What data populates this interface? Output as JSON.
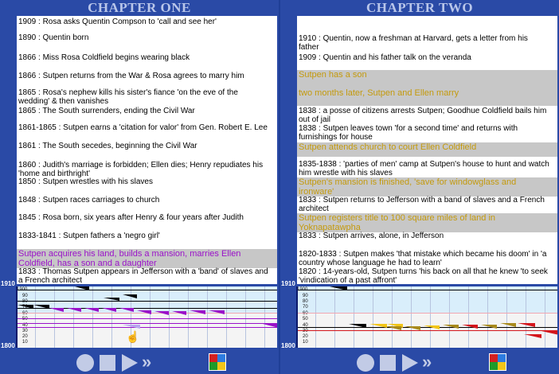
{
  "panels": [
    {
      "title": "CHAPTER ONE",
      "events": [
        {
          "text": "1909 : Rosa asks Quentin Compson to 'call and see her'",
          "style": "normal"
        },
        {
          "text": "1890 : Quentin born",
          "style": "normal"
        },
        {
          "text": "1866 : Miss Rosa Coldfield begins wearing black",
          "style": "normal"
        },
        {
          "text": "1866 : Sutpen returns from the War & Rosa agrees to marry him",
          "style": "normal"
        },
        {
          "text": "1865 : Rosa's nephew kills his sister's fiance 'on the eve of the wedding' & then vanishes",
          "style": "normal"
        },
        {
          "text": "1865 : The South surrenders, ending the Civil War",
          "style": "normal"
        },
        {
          "text": "1861-1865 : Sutpen earns a 'citation for valor' from Gen. Robert E. Lee",
          "style": "normal"
        },
        {
          "text": "1861 : The South secedes, beginning the Civil War",
          "style": "normal"
        },
        {
          "text": "1860 : Judith's marriage is forbidden; Ellen dies; Henry repudiates his 'home and  birthright'",
          "style": "normal"
        },
        {
          "text": "1850 : Sutpen wrestles with his slaves",
          "style": "normal"
        },
        {
          "text": "1848 : Sutpen races carriages to church",
          "style": "normal"
        },
        {
          "text": "1845 : Rosa born, six years after Henry & four years after Judith",
          "style": "normal"
        },
        {
          "text": "1833-1841 : Sutpen fathers a 'negro girl'",
          "style": "normal"
        },
        {
          "text": "Sutpen acquires his land, builds a mansion, marries Ellen Coldfield, has a son and a daughter",
          "style": "purple"
        },
        {
          "text": "1833 : Thomas Sutpen appears in Jefferson with a 'band' of slaves and a French architect",
          "style": "normal"
        }
      ]
    },
    {
      "title": "CHAPTER TWO",
      "events": [
        {
          "text": "1910 : Quentin, now a freshman at Harvard, gets a letter from his father",
          "style": "normal"
        },
        {
          "text": "1909 : Quentin and his father talk on the veranda",
          "style": "normal"
        },
        {
          "text": "Sutpen has a son",
          "style": "gold"
        },
        {
          "text": "two months later, Sutpen and Ellen marry",
          "style": "gold"
        },
        {
          "text": "1838 : a posse of citizens arrests Sutpen; Goodhue Coldfield bails him out of jail",
          "style": "normal"
        },
        {
          "text": "1838 : Sutpen leaves town 'for a second time' and returns with furnishings for house",
          "style": "normal"
        },
        {
          "text": "Sutpen attends church to court Ellen Coldfield",
          "style": "gold"
        },
        {
          "text": "1835-1838 : 'parties of men' camp at Sutpen's house to hunt and watch him wrestle with his slaves",
          "style": "normal"
        },
        {
          "text": "Sutpen's mansion is finished, 'save for windowglass and ironware'",
          "style": "gold"
        },
        {
          "text": "1833 : Sutpen returns to Jefferson with a band of slaves and a French architect",
          "style": "normal"
        },
        {
          "text": "Sutpen registers title to 100 square miles of land in Yoknapatawpha",
          "style": "gold"
        },
        {
          "text": "1833 : Sutpen arrives, alone, in Jefferson",
          "style": "normal"
        },
        {
          "text": "1820-1833 : Sutpen makes 'that mistake which became his doom' in 'a country whose language he had to learn'",
          "style": "normal"
        },
        {
          "text": "1820 : 14-years-old, Sutpen turns 'his back on all that he knew 'to seek 'vindication of a past affront'",
          "style": "normal"
        }
      ]
    }
  ],
  "timeline": {
    "year_top": "1910",
    "year_bottom": "1800",
    "decade_ticks": [
      "1900",
      "90",
      "80",
      "70",
      "60",
      "50",
      "40",
      "30",
      "20",
      "10"
    ],
    "flag_colors": {
      "black": "#000000",
      "purple": "#9a12c9",
      "gold": "#f2c618",
      "olive": "#a88a1c",
      "red": "#d4161c",
      "lightpurple": "#b9a6f0"
    }
  },
  "controls": {
    "record_icon": "circle-icon",
    "stop_icon": "square-icon",
    "play_icon": "play-icon",
    "fast_forward_icon": "fast-forward-icon",
    "chapters_icon": "four-color-grid-icon"
  }
}
